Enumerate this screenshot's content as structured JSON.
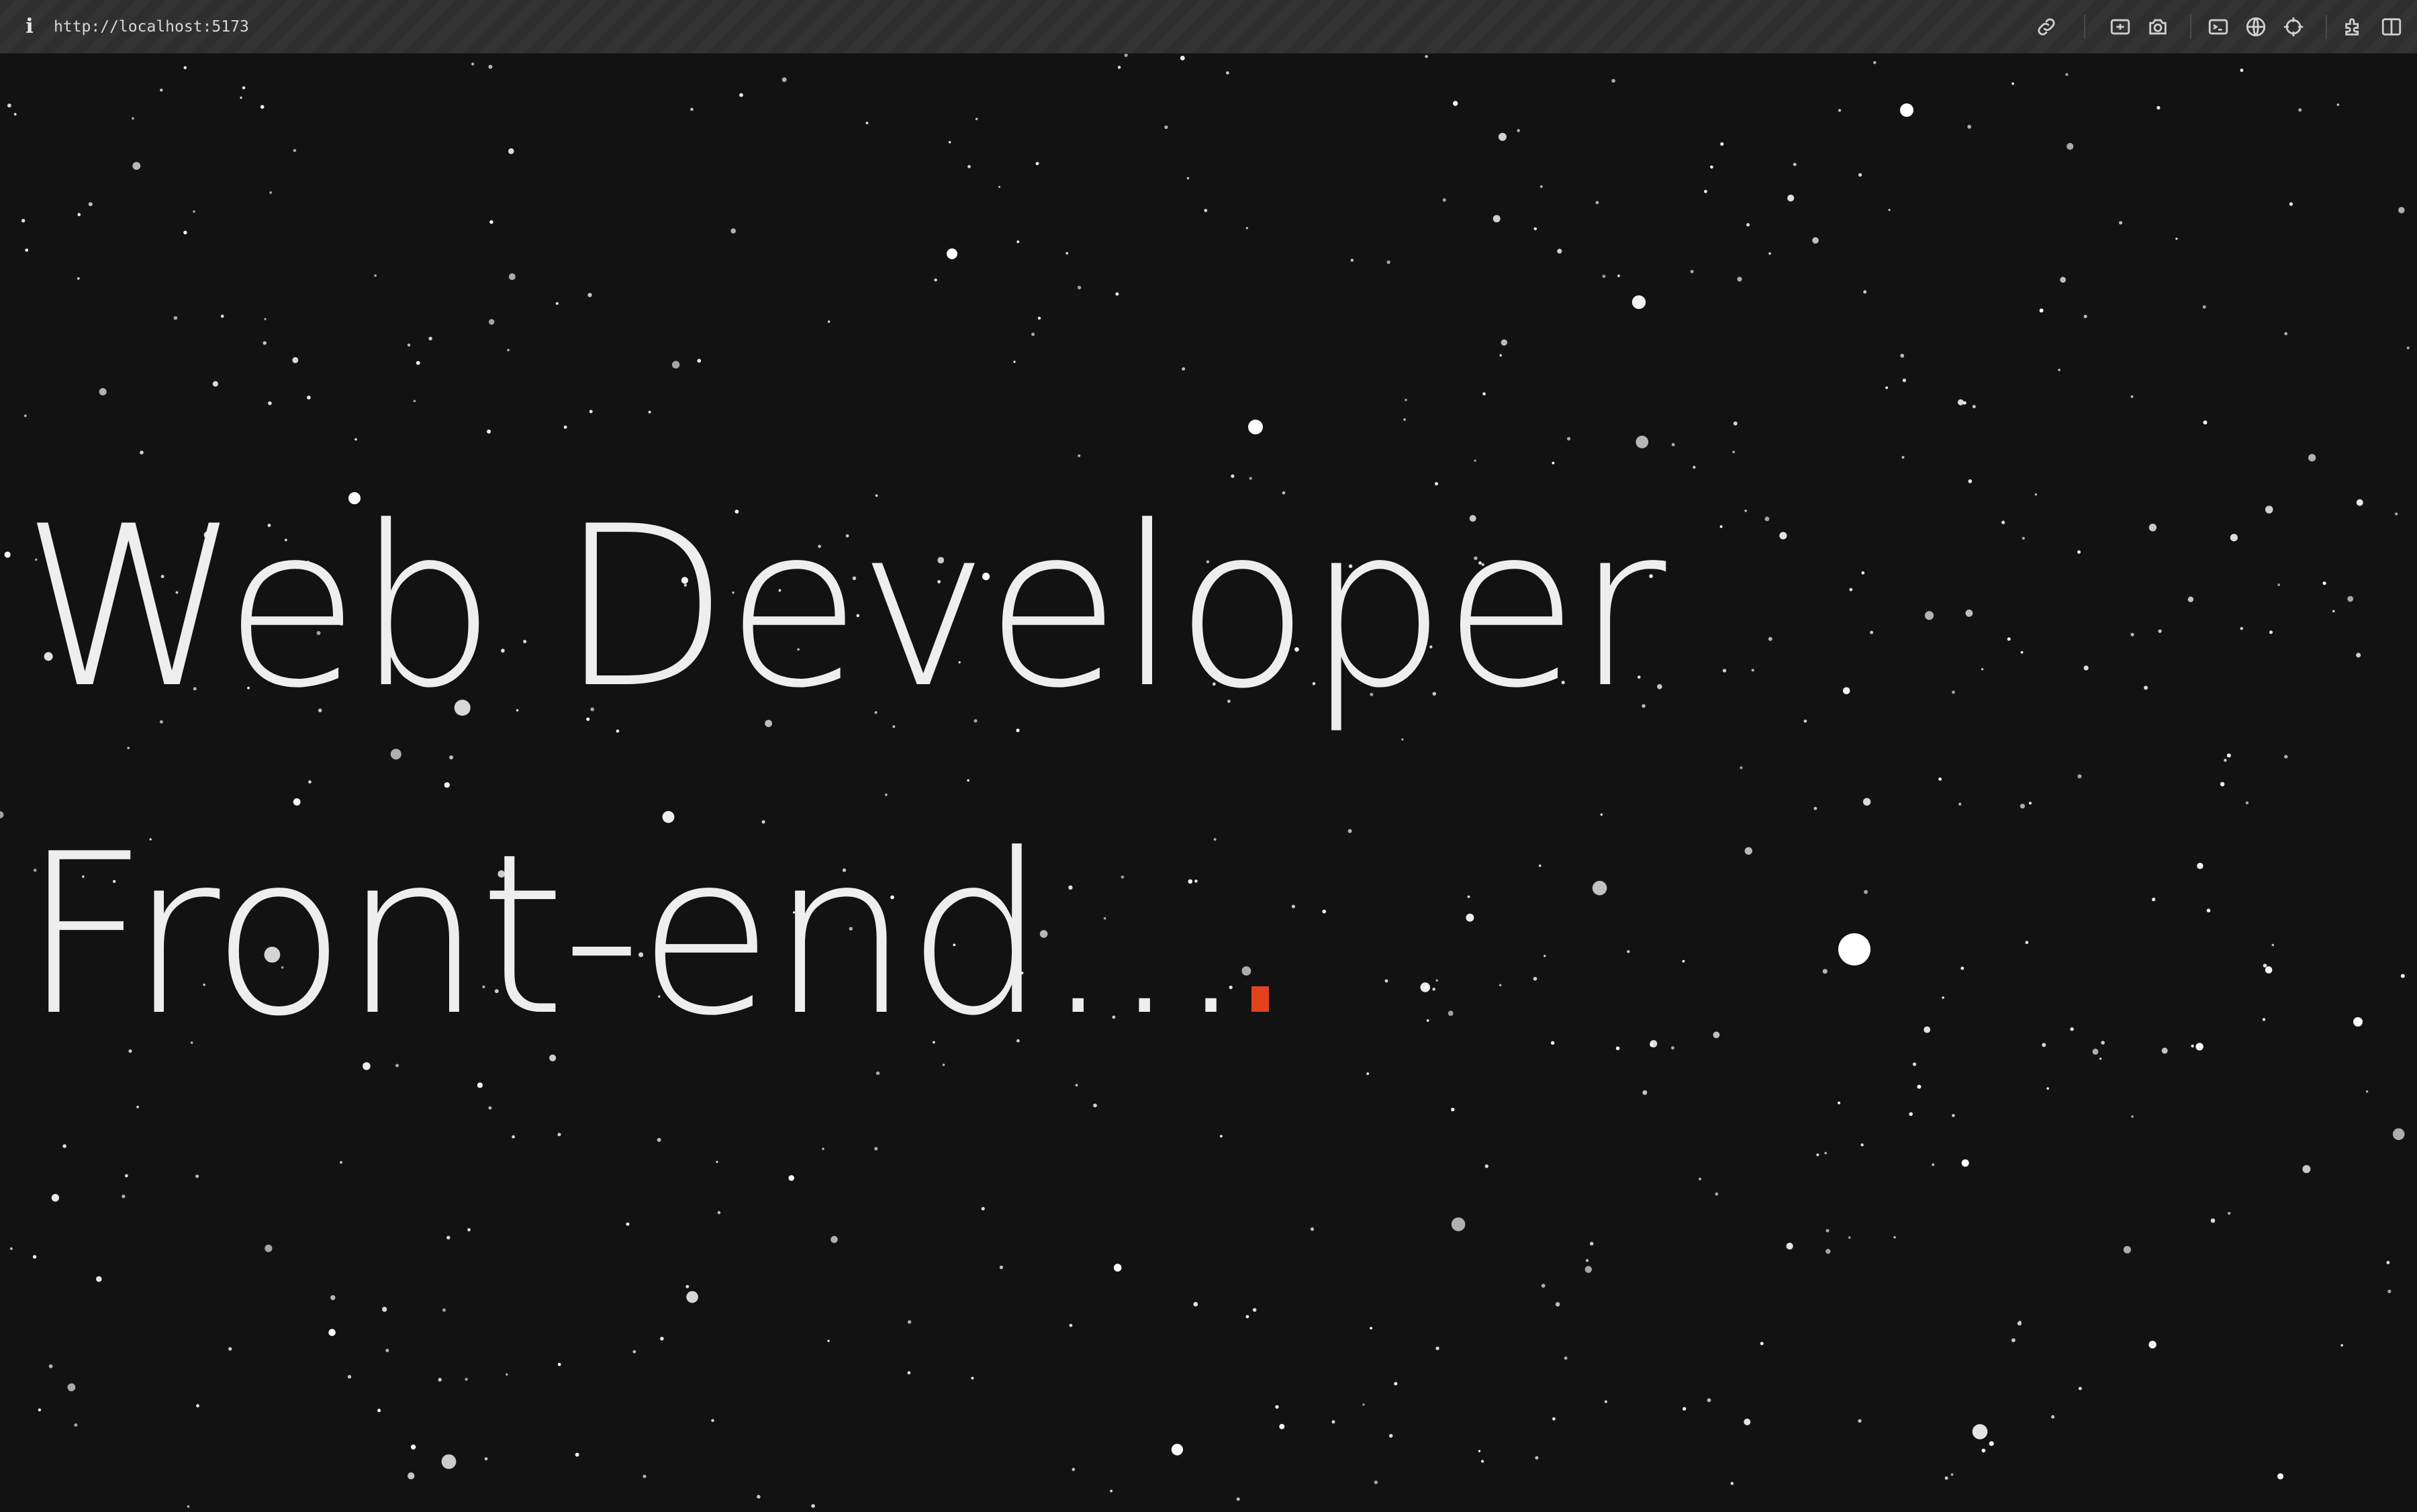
{
  "browser": {
    "url": "http://localhost:5173",
    "info_icon": "info-icon",
    "toolbar_icons": [
      "link-icon",
      "screenshot-area-icon",
      "camera-icon",
      "terminal-icon",
      "globe-icon",
      "crosshair-icon",
      "extensions-icon",
      "split-view-icon"
    ]
  },
  "hero": {
    "title": "Web Developer",
    "subtitle": "Front-end...",
    "caret_color": "#e2431e",
    "text_color": "#eeeeee"
  },
  "colors": {
    "background": "#121212",
    "stars": "#ffffff"
  }
}
